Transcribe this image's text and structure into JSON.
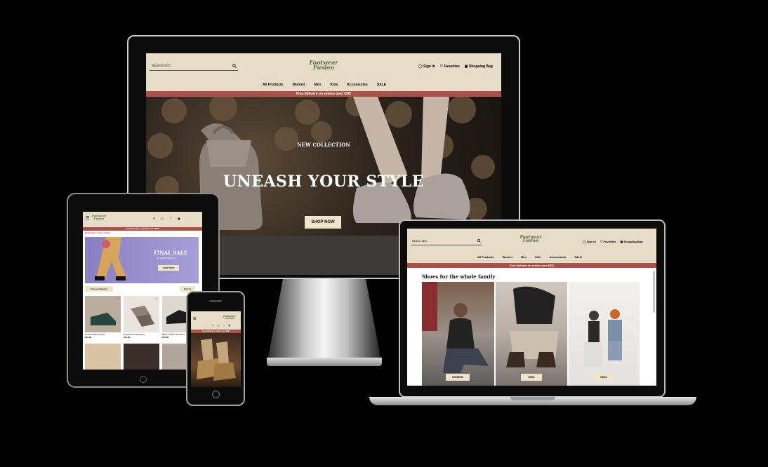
{
  "brand": {
    "logo_line1": "Footwear",
    "logo_line2": "Fusion",
    "header_bg": "#e6dcc7",
    "banner_bg": "#a9524a"
  },
  "header": {
    "search_placeholder": "Search item",
    "sign_in": "Sign In",
    "favorites": "Favorites",
    "bag": "Shopping Bag"
  },
  "nav": [
    "All Products",
    "Women",
    "Men",
    "Kids",
    "Accessories",
    "SALE"
  ],
  "banner_text": "Free delivery on orders over €50!",
  "hero": {
    "kicker": "NEW COLLECTION",
    "headline": "UNEASH YOUR STYLE",
    "cta": "SHOP NOW"
  },
  "laptop": {
    "section_title": "Shoes for the whole family",
    "cards": [
      "WOMEN",
      "MEN",
      "KIDS"
    ]
  },
  "tablet": {
    "breadcrumb": "All Products / New_arrivals",
    "sale_title": "FINAL SALE",
    "sale_sub": "Up to 80% Discount",
    "sale_cta": "SHOP NOW",
    "filter": "Choose Category",
    "sort": "Sort by",
    "products": [
      {
        "name": "Green Suede Oxford",
        "price": "€49.99"
      },
      {
        "name": "Polo Flannel Sneakers",
        "price": "€54.99"
      },
      {
        "name": "Black Leather Sneakers",
        "price": "€59.99"
      }
    ]
  }
}
